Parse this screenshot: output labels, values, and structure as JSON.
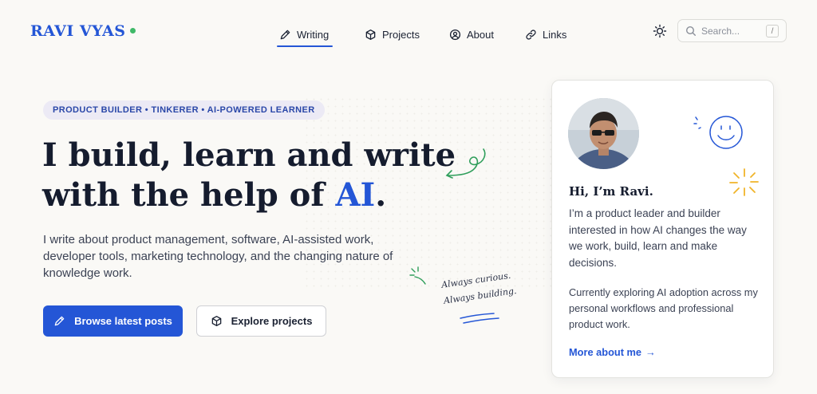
{
  "brand": {
    "name": "RAVI VYAS",
    "status_color": "#3fb968"
  },
  "nav": {
    "items": [
      {
        "label": "Writing",
        "icon": "pencil-icon",
        "active": true
      },
      {
        "label": "Projects",
        "icon": "cube-icon",
        "active": false
      },
      {
        "label": "About",
        "icon": "person-icon",
        "active": false
      },
      {
        "label": "Links",
        "icon": "link-icon",
        "active": false
      }
    ]
  },
  "theme_toggle": {
    "icon": "sun-icon"
  },
  "search": {
    "placeholder": "Search...",
    "shortcut": "/"
  },
  "hero": {
    "tagline": "PRODUCT BUILDER • TINKERER • AI-POWERED LEARNER",
    "headline_part1": "I build, learn and write",
    "headline_part2": "with the help of ",
    "headline_accent": "AI",
    "headline_end": ".",
    "lead": "I write about product management, software, AI-assisted work, developer tools, marketing technology, and the changing nature of knowledge work.",
    "primary_button": "Browse latest posts",
    "secondary_button": "Explore projects",
    "handnote_line1": "Always curious.",
    "handnote_line2": "Always building."
  },
  "card": {
    "greeting": "Hi, I’m Ravi.",
    "bio": "I’m a product leader and builder interested in how AI changes the way we work, build, learn and make decisions.",
    "now": "Currently exploring AI adoption across my personal workflows and professional product work.",
    "link": "More about me",
    "link_arrow": "→"
  },
  "colors": {
    "accent": "#2456d6",
    "background": "#faf9f6",
    "doodle_green": "#2f9e5b",
    "doodle_yellow": "#f0b429"
  }
}
